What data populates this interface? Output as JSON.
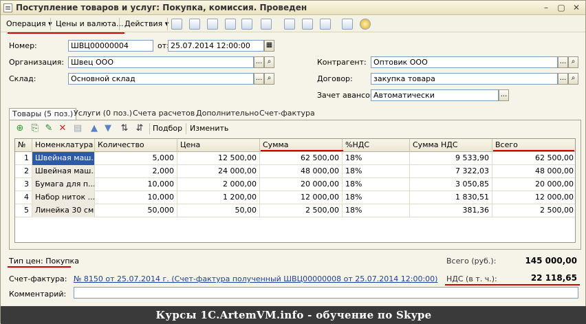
{
  "window": {
    "title": "Поступление товаров и услуг: Покупка, комиссия. Проведен",
    "buttons": [
      "–",
      "▢",
      "✕"
    ]
  },
  "toolbar": {
    "operation": "Операция",
    "prices": "Цены и валюта...",
    "actions": "Действия"
  },
  "form": {
    "number_label": "Номер:",
    "number_value": "ШВЦ00000004",
    "date_label": "от:",
    "date_value": "25.07.2014 12:00:00",
    "org_label": "Организация:",
    "org_value": "Швец ООО",
    "warehouse_label": "Склад:",
    "warehouse_value": "Основной склад",
    "counterparty_label": "Контрагент:",
    "counterparty_value": "Оптовик ООО",
    "contract_label": "Договор:",
    "contract_value": "закупка товара",
    "advance_label": "Зачет авансов:",
    "advance_value": "Автоматически"
  },
  "tabs": [
    "Товары (5 поз.)",
    "Услуги (0 поз.)",
    "Счета расчетов",
    "Дополнительно",
    "Счет-фактура"
  ],
  "table_toolbar": {
    "selection": "Подбор",
    "change": "Изменить"
  },
  "table": {
    "columns": [
      "№",
      "Номенклатура",
      "Количество",
      "Цена",
      "Сумма",
      "%НДС",
      "Сумма НДС",
      "Всего"
    ],
    "rows": [
      [
        "1",
        "Швейная маш...",
        "5,000",
        "12 500,00",
        "62 500,00",
        "18%",
        "9 533,90",
        "62 500,00"
      ],
      [
        "2",
        "Швейная маш...",
        "2,000",
        "24 000,00",
        "48 000,00",
        "18%",
        "7 322,03",
        "48 000,00"
      ],
      [
        "3",
        "Бумага для п...",
        "10,000",
        "2 000,00",
        "20 000,00",
        "18%",
        "3 050,85",
        "20 000,00"
      ],
      [
        "4",
        "Набор ниток ...",
        "10,000",
        "1 200,00",
        "12 000,00",
        "18%",
        "1 830,51",
        "12 000,00"
      ],
      [
        "5",
        "Линейка 30 см",
        "50,000",
        "50,00",
        "2 500,00",
        "18%",
        "381,36",
        "2 500,00"
      ]
    ]
  },
  "footer": {
    "price_type": "Тип цен: Покупка",
    "total_label": "Всего (руб.):",
    "total_value": "145 000,00",
    "vat_label": "НДС (в т. ч.):",
    "vat_value": "22 118,65",
    "invoice_label": "Счет-фактура:",
    "invoice_value": "№ 8150 от 25.07.2014 г. (Счет-фактура полученный ШВЦ00000008 от 25.07.2014 12:00:00)",
    "comment_label": "Комментарий:",
    "comment_value": ""
  },
  "banner": "Курсы 1C.ArtemVM.info - обучение по Skype",
  "colors": {
    "accent_red": "#d40000",
    "selection": "#2c5aa8",
    "link": "#1f3fa0"
  }
}
